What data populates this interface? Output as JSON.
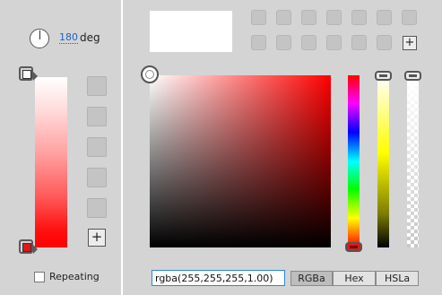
{
  "gradient": {
    "angle_value": "180",
    "angle_unit": "deg",
    "stops": [
      {
        "name": "top",
        "color": "#ffffff"
      },
      {
        "name": "bottom",
        "color": "#e8141c"
      }
    ],
    "repeating_label": "Repeating",
    "repeating_checked": false,
    "add_preset_label": "+"
  },
  "picker": {
    "add_swatch_label": "+",
    "value": "rgba(255,255,255,1.00)",
    "modes": [
      "RGBa",
      "Hex",
      "HSLa"
    ],
    "active_mode": "RGBa"
  }
}
